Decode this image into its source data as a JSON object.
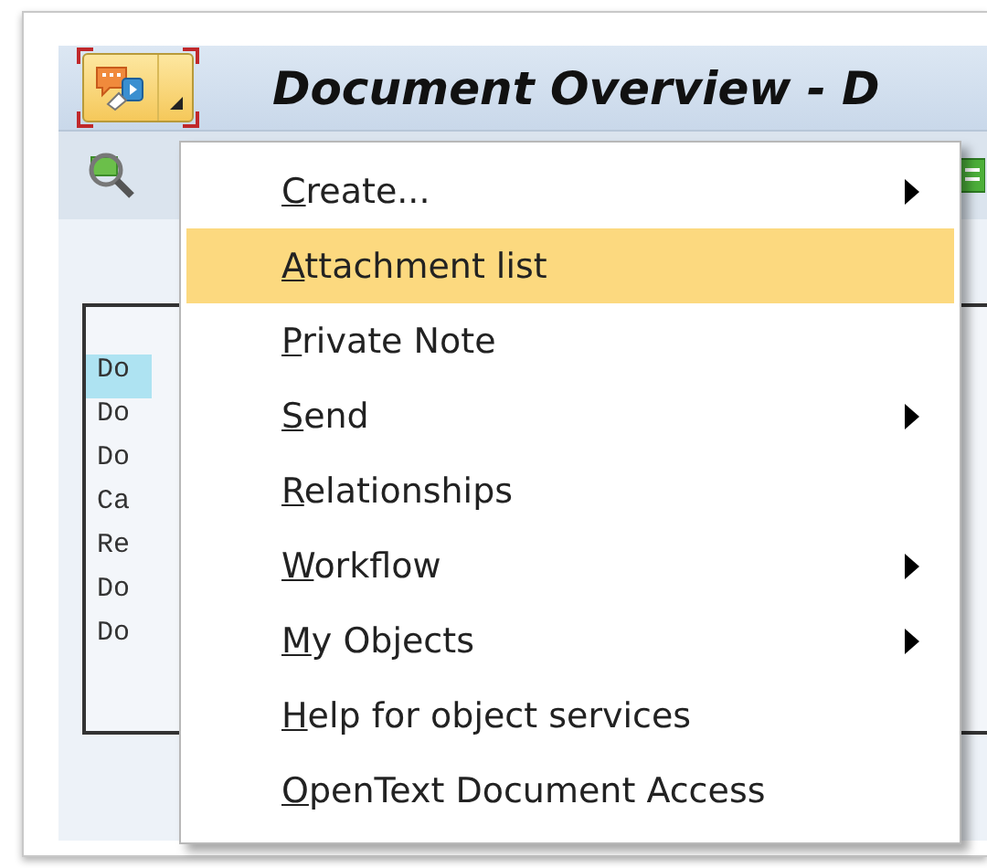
{
  "window": {
    "title": "Document Overview - D"
  },
  "list": {
    "rows": [
      {
        "column_1": "Do",
        "selected": true
      },
      {
        "column_1": "Do",
        "selected": false
      },
      {
        "column_1": "Do",
        "selected": false
      },
      {
        "column_1": "Ca",
        "selected": false
      },
      {
        "column_1": "Re",
        "selected": false
      },
      {
        "column_1": "Do",
        "selected": false
      },
      {
        "column_1": "Do",
        "selected": false
      }
    ]
  },
  "menu": {
    "items": [
      {
        "label": "Create...",
        "submenu": true,
        "selected": false
      },
      {
        "label": "Attachment list",
        "submenu": false,
        "selected": true
      },
      {
        "label": "Private Note",
        "submenu": false,
        "selected": false
      },
      {
        "label": "Send",
        "submenu": true,
        "selected": false
      },
      {
        "label": "Relationships",
        "submenu": false,
        "selected": false
      },
      {
        "label": "Workflow",
        "submenu": true,
        "selected": false
      },
      {
        "label": "My Objects",
        "submenu": true,
        "selected": false
      },
      {
        "label": "Help for object services",
        "submenu": false,
        "selected": false
      },
      {
        "label": "OpenText Document Access",
        "submenu": false,
        "selected": false
      }
    ]
  }
}
